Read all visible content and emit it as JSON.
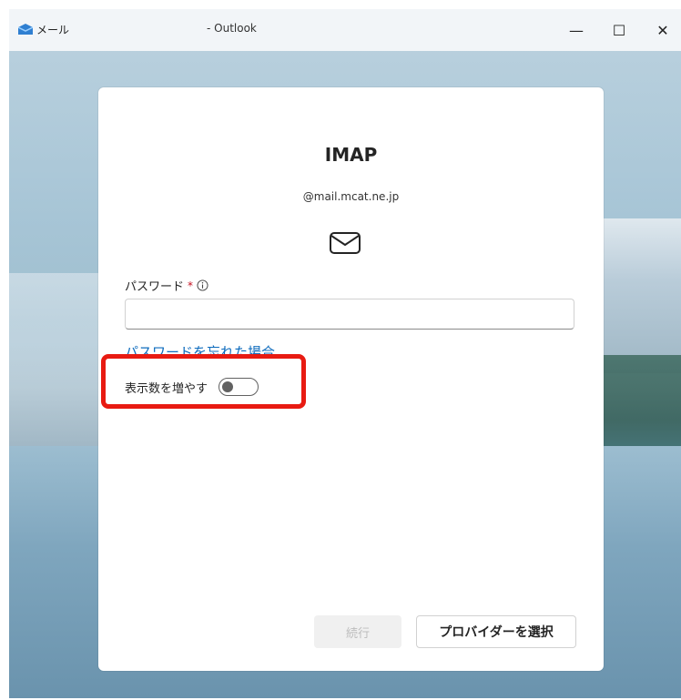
{
  "titlebar": {
    "app_name": "メール",
    "doc_title": "- Outlook",
    "minimize_symbol": "—",
    "maximize_symbol": "☐",
    "close_symbol": "✕"
  },
  "dialog": {
    "protocol": "IMAP",
    "email": "@mail.mcat.ne.jp",
    "mail_icon": "envelope-icon",
    "password_label": "パスワード",
    "required_mark": "*",
    "info_icon": "info-icon",
    "password_value": "",
    "forgot_link": "パスワードを忘れた場合",
    "toggle_label": "表示数を増やす",
    "toggle_on": false,
    "continue_button": "続行",
    "provider_button": "プロバイダーを選択"
  },
  "colors": {
    "link": "#0f6cbd",
    "required": "#c50f1f",
    "highlight": "#e81b12"
  }
}
